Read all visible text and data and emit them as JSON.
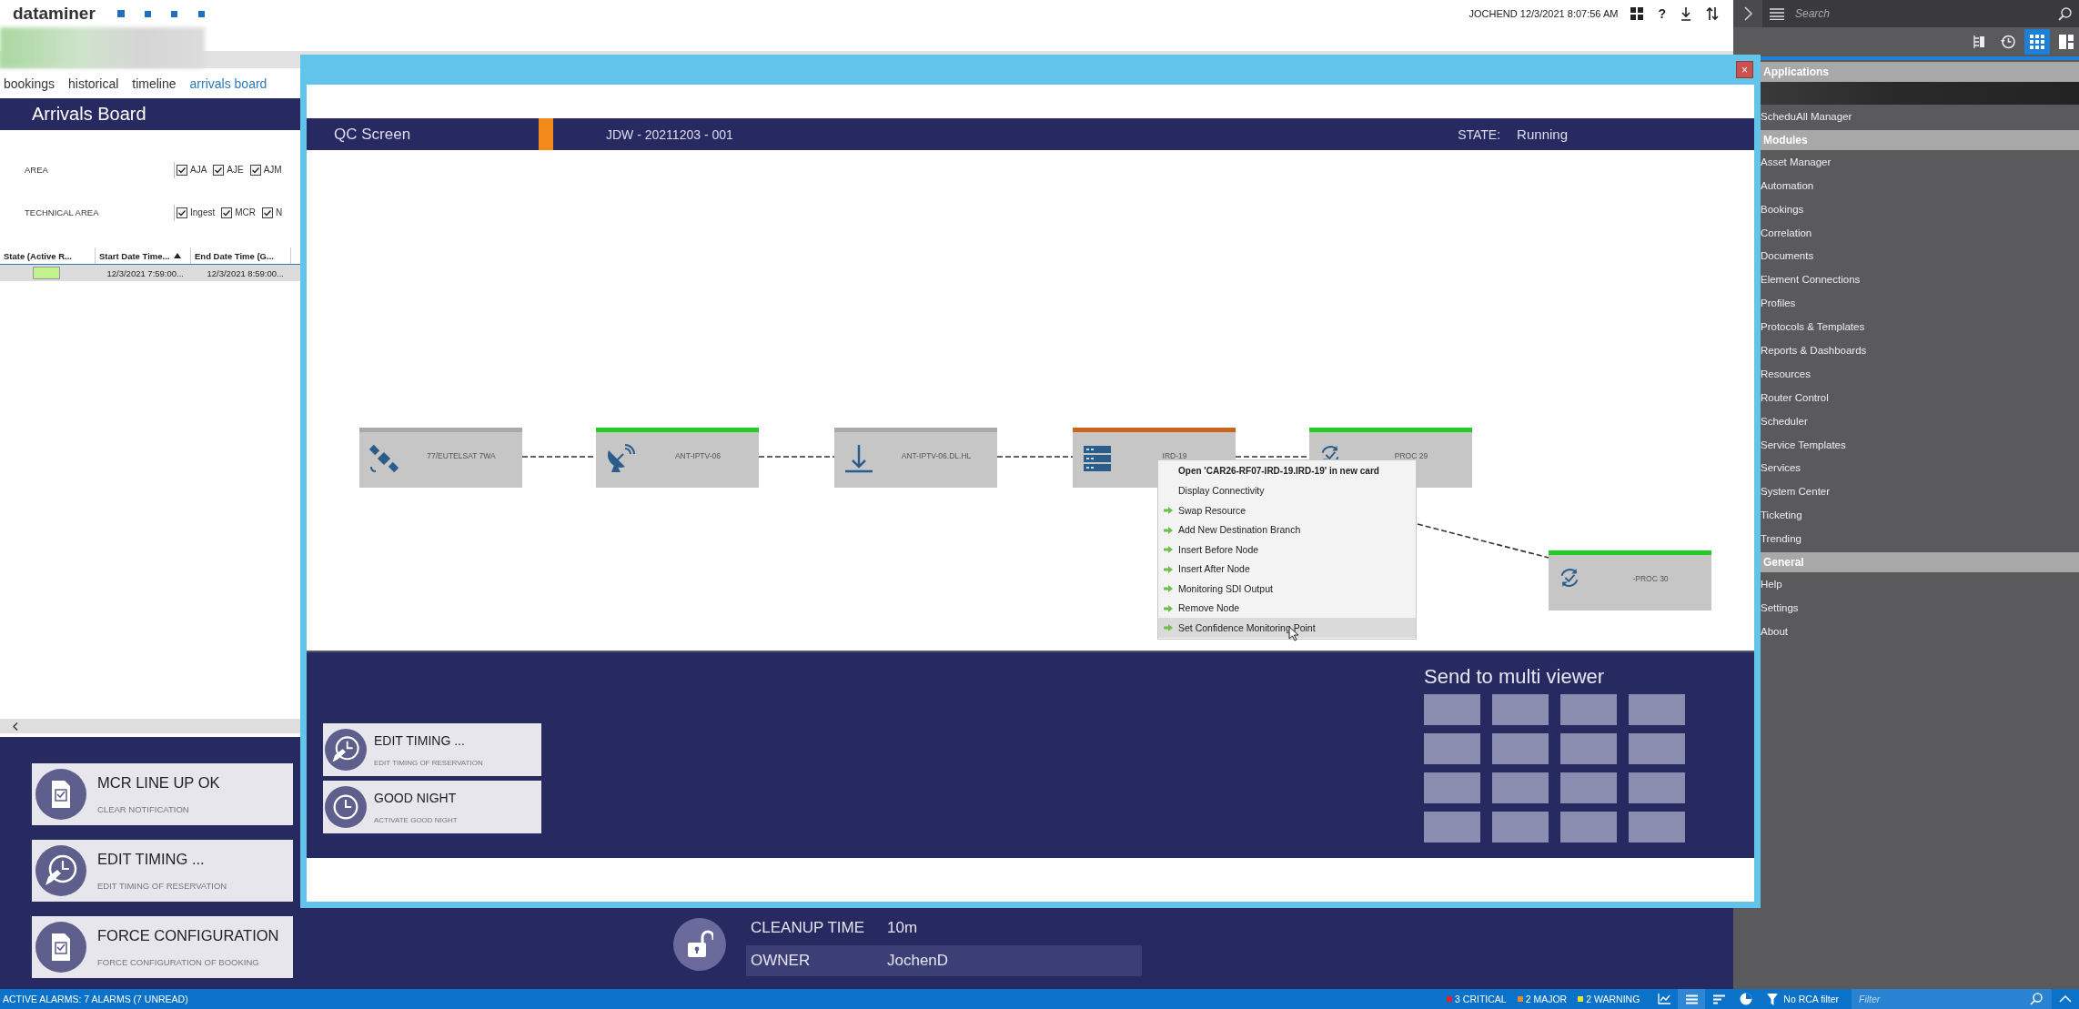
{
  "app": {
    "logo": "dataminer",
    "user_time": "JOCHEND 12/3/2021 8:07:56 AM",
    "help": "?"
  },
  "tabs": [
    {
      "label": "bookings",
      "selected": false
    },
    {
      "label": "historical",
      "selected": false
    },
    {
      "label": "timeline",
      "selected": false
    },
    {
      "label": "arrivals board",
      "selected": true
    }
  ],
  "board": {
    "title": "Arrivals Board",
    "filters": [
      {
        "label": "AREA",
        "options": [
          {
            "label": "AJA",
            "checked": true
          },
          {
            "label": "AJE",
            "checked": true
          },
          {
            "label": "AJM",
            "checked": true
          }
        ]
      },
      {
        "label": "TECHNICAL AREA",
        "options": [
          {
            "label": "Ingest",
            "checked": true
          },
          {
            "label": "MCR",
            "checked": true
          },
          {
            "label": "N",
            "checked": true
          }
        ]
      }
    ],
    "table": {
      "state_column": "State (Active R...",
      "columns": [
        "Start Date Time...",
        "End Date Time (G..."
      ],
      "rows": [
        {
          "color": "#c2f28e",
          "cells": [
            "12/3/2021 7:59:00...",
            "12/3/2021 8:59:00..."
          ]
        }
      ]
    }
  },
  "actions": [
    {
      "kind": "checklist",
      "title": "MCR LINE UP OK",
      "subtitle": "CLEAR NOTIFICATION"
    },
    {
      "kind": "clock-edit",
      "title": "EDIT TIMING ...",
      "subtitle": "EDIT TIMING OF RESERVATION"
    },
    {
      "kind": "checklist",
      "title": "FORCE CONFIGURATION",
      "subtitle": "FORCE CONFIGURATION OF BOOKING"
    }
  ],
  "details": [
    {
      "label": "CLEANUP TIME",
      "value": "10m"
    },
    {
      "label": "OWNER",
      "value": "JochenD"
    }
  ],
  "qc": {
    "close": "×",
    "title": "QC Screen",
    "booking": "JDW - 20211203 - 001",
    "state_label": "STATE:",
    "state": "Running",
    "nodes": [
      {
        "kind": "satellite",
        "label": "77/EUTELSAT 7WA",
        "color": "#a9a9a9"
      },
      {
        "kind": "dish",
        "label": "ANT-IPTV-06",
        "color": "#22cc22"
      },
      {
        "kind": "antenna",
        "label": "ANT-IPTV-06.DL.HL",
        "color": "#a9a9a9"
      },
      {
        "kind": "server",
        "label": "IRD-19",
        "color": "#c8661e"
      },
      {
        "kind": "process",
        "label": "PROC 29",
        "color": "#22cc22"
      },
      {
        "kind": "process",
        "label": "-PROC 30",
        "color": "#22cc22"
      }
    ],
    "context_menu": [
      {
        "kind": "header",
        "label": "Open 'CAR26-RF07-IRD-19.IRD-19' in new card",
        "selected": false
      },
      {
        "kind": "plain",
        "label": "Display Connectivity",
        "selected": false
      },
      {
        "kind": "action",
        "label": "Swap Resource",
        "selected": false
      },
      {
        "kind": "action",
        "label": "Add New Destination Branch",
        "selected": false
      },
      {
        "kind": "action",
        "label": "Insert Before Node",
        "selected": false
      },
      {
        "kind": "action",
        "label": "Insert After Node",
        "selected": false
      },
      {
        "kind": "action",
        "label": "Monitoring SDI Output",
        "selected": false
      },
      {
        "kind": "action",
        "label": "Remove Node",
        "selected": false
      },
      {
        "kind": "action",
        "label": "Set Confidence Monitoring Point",
        "selected": true
      }
    ],
    "actions": [
      {
        "kind": "clock-edit",
        "title": "EDIT TIMING ...",
        "subtitle": "EDIT TIMING OF RESERVATION"
      },
      {
        "kind": "clock",
        "title": "GOOD NIGHT",
        "subtitle": "ACTIVATE GOOD NIGHT"
      }
    ],
    "multi_viewer": {
      "title": "Send to multi viewer"
    }
  },
  "sidebar": {
    "search": {
      "placeholder": "Search"
    },
    "tools": [
      {
        "kind": "tree",
        "selected": false
      },
      {
        "kind": "history",
        "selected": false
      },
      {
        "kind": "grid",
        "selected": true
      },
      {
        "kind": "layout",
        "selected": false
      }
    ],
    "sections": [
      {
        "title": "Applications",
        "items": [
          "ScheduAll Manager"
        ]
      },
      {
        "title": "Modules",
        "items": [
          "Asset Manager",
          "Automation",
          "Bookings",
          "Correlation",
          "Documents",
          "Element Connections",
          "Profiles",
          "Protocols & Templates",
          "Reports & Dashboards",
          "Resources",
          "Router Control",
          "Scheduler",
          "Service Templates",
          "Services",
          "System Center",
          "Ticketing",
          "Trending"
        ]
      },
      {
        "title": "General",
        "items": [
          "Help",
          "Settings",
          "About"
        ]
      }
    ]
  },
  "status_bar": {
    "alarms": "ACTIVE ALARMS: 7 ALARMS (7 UNREAD)",
    "counts": [
      {
        "label": "3 CRITICAL",
        "color": "#e0202a"
      },
      {
        "label": "2 MAJOR",
        "color": "#e8892a"
      },
      {
        "label": "2 WARNING",
        "color": "#e6e62a"
      }
    ],
    "views": [
      {
        "kind": "chart",
        "selected": false
      },
      {
        "kind": "list",
        "selected": true
      },
      {
        "kind": "sort",
        "selected": false
      },
      {
        "kind": "pie",
        "selected": false
      }
    ],
    "rca": "No RCA filter",
    "filter": {
      "placeholder": "Filter"
    }
  }
}
